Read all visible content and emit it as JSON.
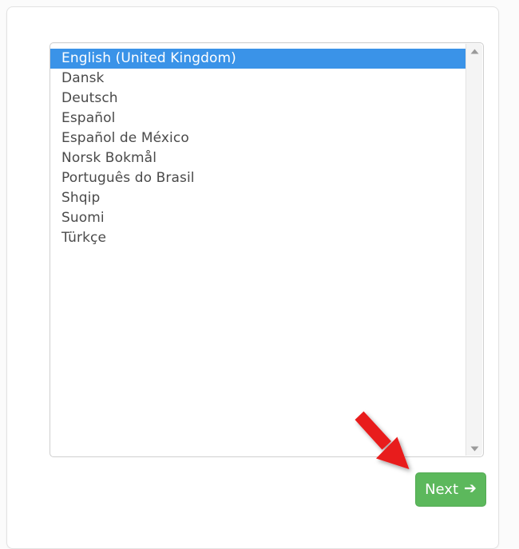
{
  "dialog": {
    "name": "language-selection-dialog"
  },
  "language_list": {
    "selected_index": 0,
    "items": [
      {
        "label": "English (United Kingdom)"
      },
      {
        "label": "Dansk"
      },
      {
        "label": "Deutsch"
      },
      {
        "label": "Español"
      },
      {
        "label": "Español de México"
      },
      {
        "label": "Norsk Bokmål"
      },
      {
        "label": "Português do Brasil"
      },
      {
        "label": "Shqip"
      },
      {
        "label": "Suomi"
      },
      {
        "label": "Türkçe"
      }
    ]
  },
  "scrollbar": {
    "up_icon": "scroll-up-arrow-icon",
    "down_icon": "scroll-down-arrow-icon"
  },
  "next_button": {
    "label": "Next",
    "arrow": "➔",
    "icon": "arrow-right-icon"
  },
  "annotation": {
    "icon": "red-pointer-arrow-icon"
  },
  "colors": {
    "selection_blue": "#3a93e8",
    "button_green": "#5cb85c",
    "annotation_red": "#e81c1c",
    "text_gray": "#4a4a4a",
    "panel_white": "#ffffff",
    "page_background": "#fbfbfb"
  }
}
